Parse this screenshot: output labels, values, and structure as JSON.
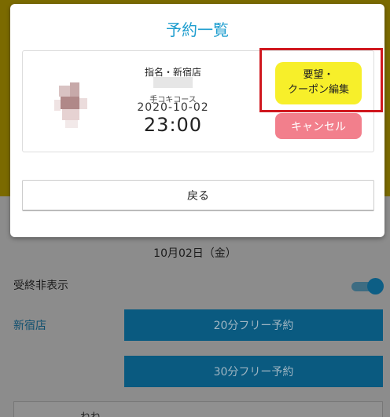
{
  "background": {
    "date": "10月02日（金）",
    "toggle_label": "受終非表示",
    "store_label": "新宿店",
    "buttons": [
      "20分フリー予約",
      "30分フリー予約"
    ],
    "bottom_text": "ねね"
  },
  "modal": {
    "title": "予約一覧",
    "reservation": {
      "line1": "指名・新宿店",
      "course": "手コキコース",
      "date": "2020-10-02",
      "time": "23:00"
    },
    "coupon_button": {
      "line1": "要望・",
      "line2": "クーポン編集"
    },
    "cancel_button": "キャンセル",
    "back_button": "戻る"
  },
  "colors": {
    "title": "#1f9ecf",
    "coupon_button": "#f7ef2a",
    "cancel_button": "#f27f8c",
    "highlight": "#d0181f"
  }
}
